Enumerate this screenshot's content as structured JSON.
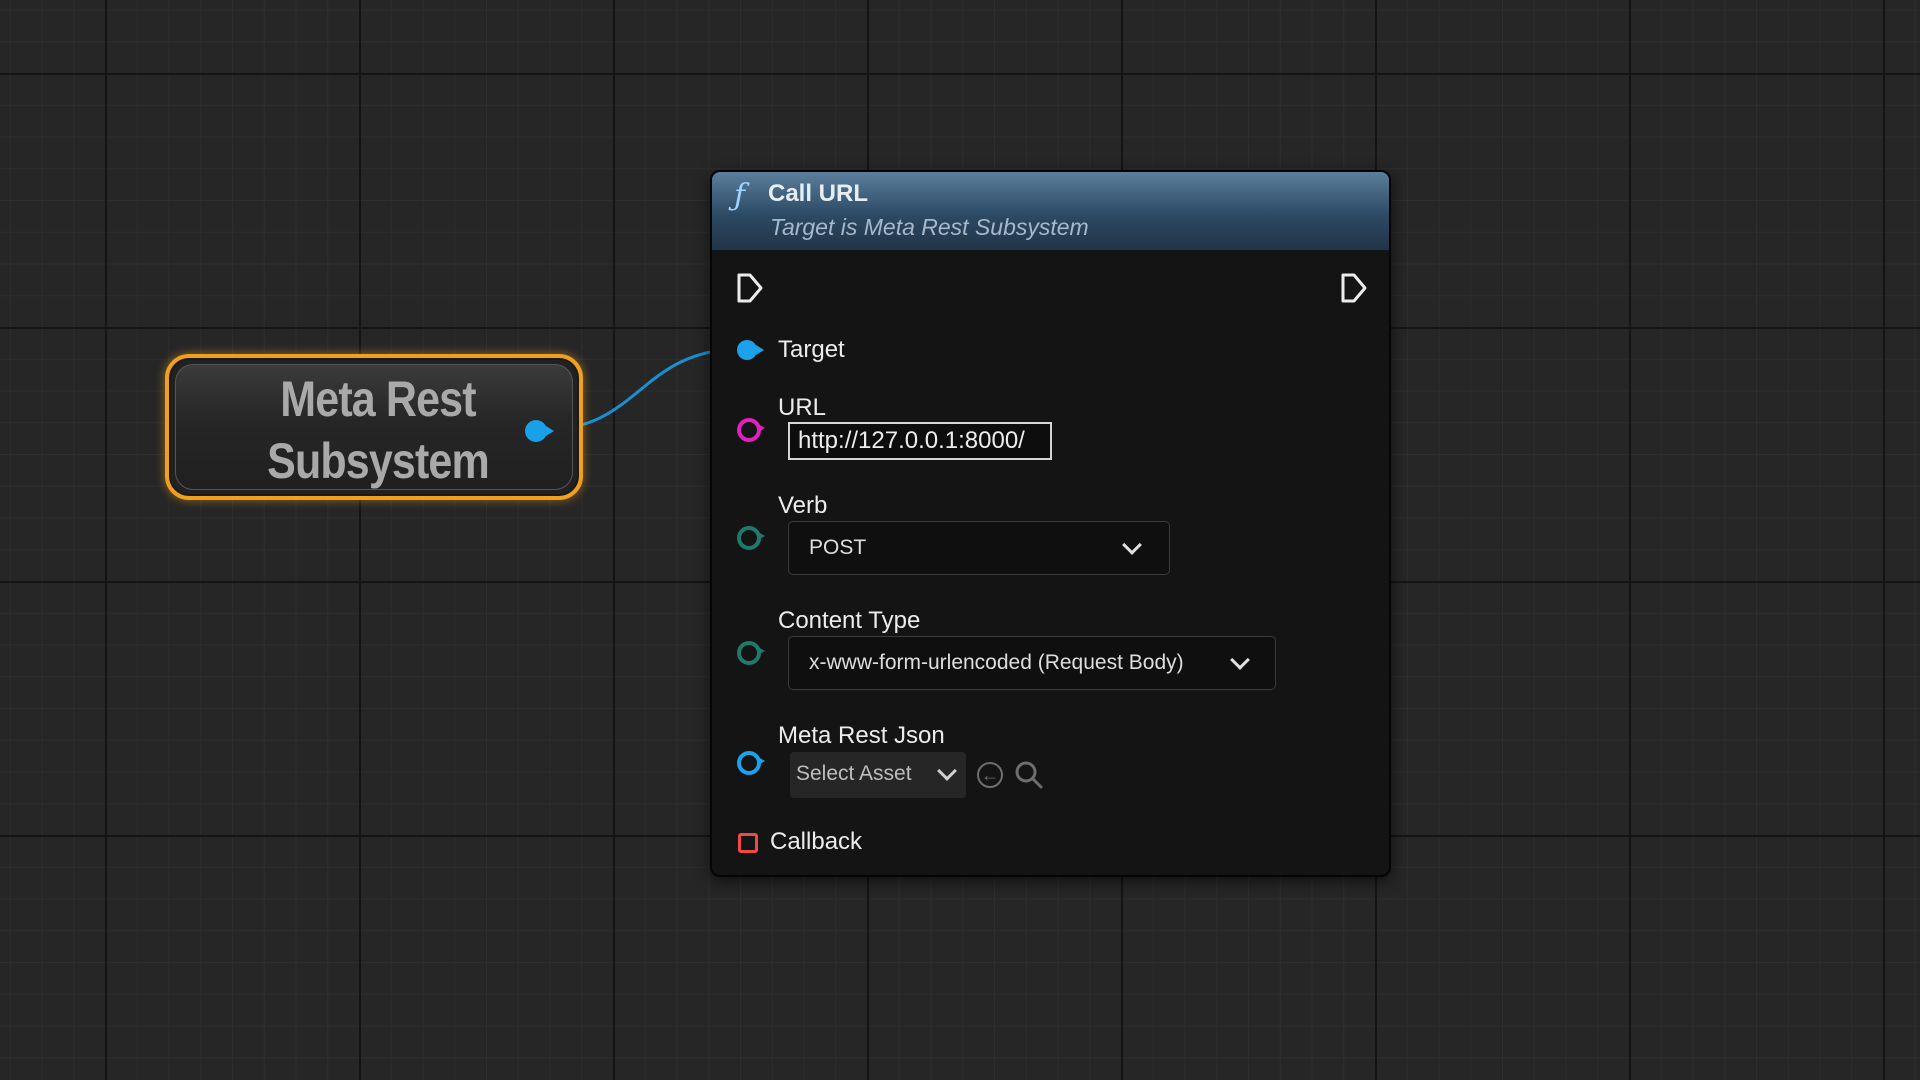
{
  "getter_node": {
    "title_line1": "Meta Rest",
    "title_line2": "Subsystem"
  },
  "node": {
    "icon": "function-icon",
    "title": "Call URL",
    "subtitle": "Target is Meta Rest Subsystem",
    "pins": {
      "target": {
        "label": "Target"
      },
      "url": {
        "label": "URL",
        "value": "http://127.0.0.1:8000/"
      },
      "verb": {
        "label": "Verb",
        "selected": "POST"
      },
      "content_type": {
        "label": "Content Type",
        "selected": "x-www-form-urlencoded (Request Body)"
      },
      "meta_rest_json": {
        "label": "Meta Rest Json",
        "asset_placeholder": "Select Asset"
      },
      "callback": {
        "label": "Callback"
      }
    }
  },
  "colors": {
    "getter_highlight": "#f0a020",
    "object_pin": "#1ca2ea",
    "string_pin": "#e020c0",
    "enum_pin": "#1f7a6c",
    "delegate_pin": "#f04a48",
    "header_top": "#5b7f9c",
    "header_bottom": "#223447"
  }
}
